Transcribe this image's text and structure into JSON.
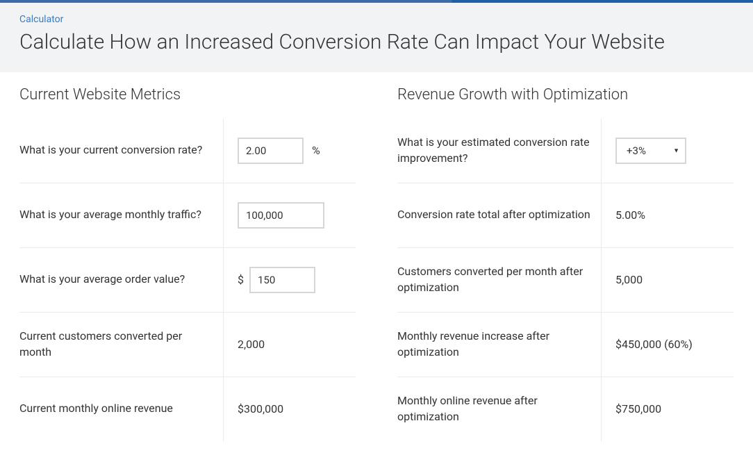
{
  "header": {
    "breadcrumb": "Calculator",
    "title": "Calculate How an Increased Conversion Rate Can Impact Your Website"
  },
  "left": {
    "heading": "Current Website Metrics",
    "rows": [
      {
        "label": "What is your current conversion rate?",
        "value": "2.00",
        "suffix": "%"
      },
      {
        "label": "What is your average monthly traffic?",
        "value": "100,000"
      },
      {
        "label": "What is your average order value?",
        "value": "150",
        "prefix": "$"
      },
      {
        "label": "Current customers converted per month",
        "value": "2,000"
      },
      {
        "label": "Current monthly online revenue",
        "value": "$300,000"
      }
    ]
  },
  "right": {
    "heading": "Revenue Growth with Optimization",
    "rows": [
      {
        "label": "What is your estimated conversion rate improvement?",
        "value": "+3%"
      },
      {
        "label": "Conversion rate total after optimization",
        "value": "5.00%"
      },
      {
        "label": "Customers converted per month after optimization",
        "value": "5,000"
      },
      {
        "label": "Monthly revenue increase after optimization",
        "value": "$450,000 (60%)"
      },
      {
        "label": "Monthly online revenue after optimization",
        "value": "$750,000"
      }
    ]
  }
}
